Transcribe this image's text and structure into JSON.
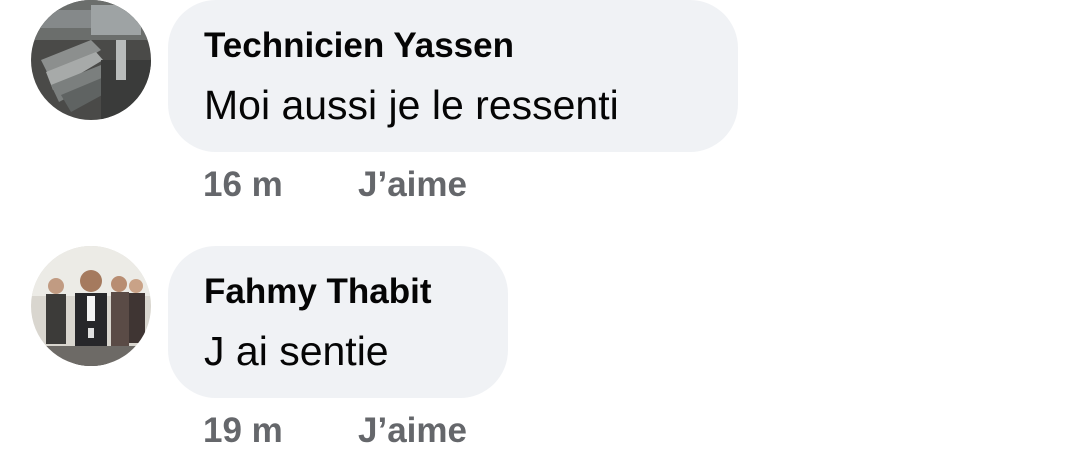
{
  "comments": [
    {
      "author": "Technicien Yassen",
      "text": "Moi aussi je le ressenti",
      "time": "16 m",
      "like_label": "J’aime",
      "avatar_icon": "industrial-pipes-photo"
    },
    {
      "author": "Fahmy Thabit",
      "text": "J ai sentie",
      "time": "19 m",
      "like_label": "J’aime",
      "avatar_icon": "group-of-people-photo"
    }
  ],
  "colors": {
    "bubble_bg": "#f0f2f5",
    "text": "#050505",
    "meta": "#65676b"
  }
}
